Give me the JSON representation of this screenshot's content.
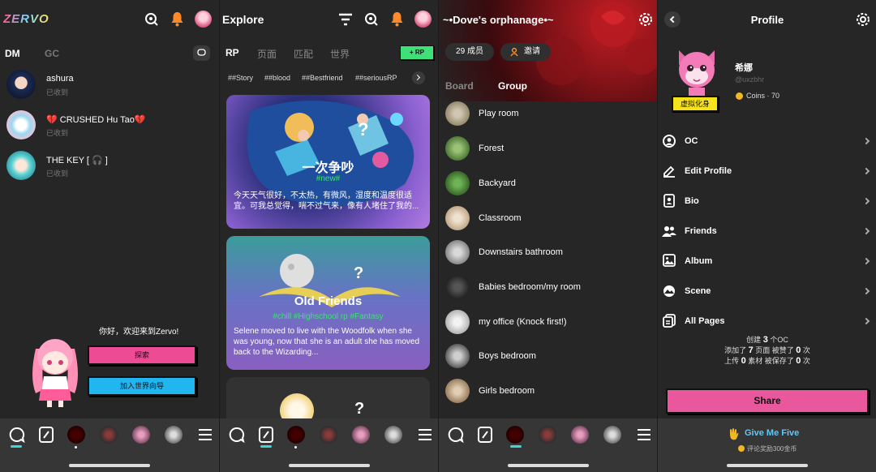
{
  "app_logo": "ZERVO",
  "dm_screen": {
    "tabs": [
      "DM",
      "GC"
    ],
    "conversations": [
      {
        "name": "ashura",
        "status": "已收到"
      },
      {
        "name": "💔 CRUSHED Hu Tao💔",
        "status": "已收到"
      },
      {
        "name": "THE KEY [ 🎧 ]",
        "status": "已收到"
      }
    ],
    "welcome": "你好，欢迎来到Zervo!",
    "explore_button": "探索",
    "join_world_button": "加入世界向导"
  },
  "explore_screen": {
    "title": "Explore",
    "tabs": [
      "RP",
      "页面",
      "匹配",
      "世界"
    ],
    "new_rp_button": "+ RP",
    "tags": [
      "##Story",
      "##blood",
      "##Bestfriend",
      "##seriousRP"
    ],
    "cards": [
      {
        "title": "一次争吵",
        "tags": "#new#",
        "desc": "今天天气很好，不太热，有微风，湿度和温度很适宜。可我总觉得，喘不过气来，像有人堵住了我的..."
      },
      {
        "title": "Old Friends",
        "tags": "#chill #Highschool rp #Fantasy",
        "desc": "Selene moved to live with the Woodfolk when she was young, now that she is an adult she has moved back to the Wizarding..."
      }
    ],
    "card3_mark": "?"
  },
  "group_screen": {
    "title": "~•Dove's orphanage•~",
    "members_button": "29 成员",
    "invite_button": "邀请",
    "tabs": [
      "Board",
      "Group"
    ],
    "channels": [
      "Play room",
      "Forest",
      "Backyard",
      "Classroom",
      "Downstairs bathroom",
      "Babies bedroom/my room",
      "my office (Knock first!)",
      "Boys bedroom",
      "Girls bedroom"
    ]
  },
  "profile_screen": {
    "title": "Profile",
    "username": "希娜",
    "handle": "@uxzbhr",
    "coins": "Coins · 70",
    "avatar_badge": "虚拟化身",
    "menu": [
      {
        "label": "OC",
        "icon": "person-circle-icon"
      },
      {
        "label": "Edit Profile",
        "icon": "pen-icon"
      },
      {
        "label": "Bio",
        "icon": "id-badge-icon"
      },
      {
        "label": "Friends",
        "icon": "friends-icon"
      },
      {
        "label": "Album",
        "icon": "image-icon"
      },
      {
        "label": "Scene",
        "icon": "scene-icon"
      },
      {
        "label": "All Pages",
        "icon": "pages-icon"
      }
    ],
    "stats": {
      "l1a": "创建",
      "l1n": "3",
      "l1b": "个OC",
      "l2a": "添加了",
      "l2n": "7",
      "l2b": "页面 被赞了",
      "l2m": "0",
      "l2c": "次",
      "l3a": "上传",
      "l3n": "0",
      "l3b": "素材 被保存了",
      "l3m": "0",
      "l3c": "次"
    },
    "share_button": "Share",
    "give_me_five": "Give Me Five",
    "give_me_five_sub": "评论奖励300金币"
  },
  "colors": {
    "accent_green": "#3fe077",
    "share_pink": "#e9579d",
    "explore_pink": "#ee4b95",
    "world_blue": "#22b6f0",
    "badge_yellow": "#f6e21a",
    "link_blue": "#63c6f6"
  }
}
